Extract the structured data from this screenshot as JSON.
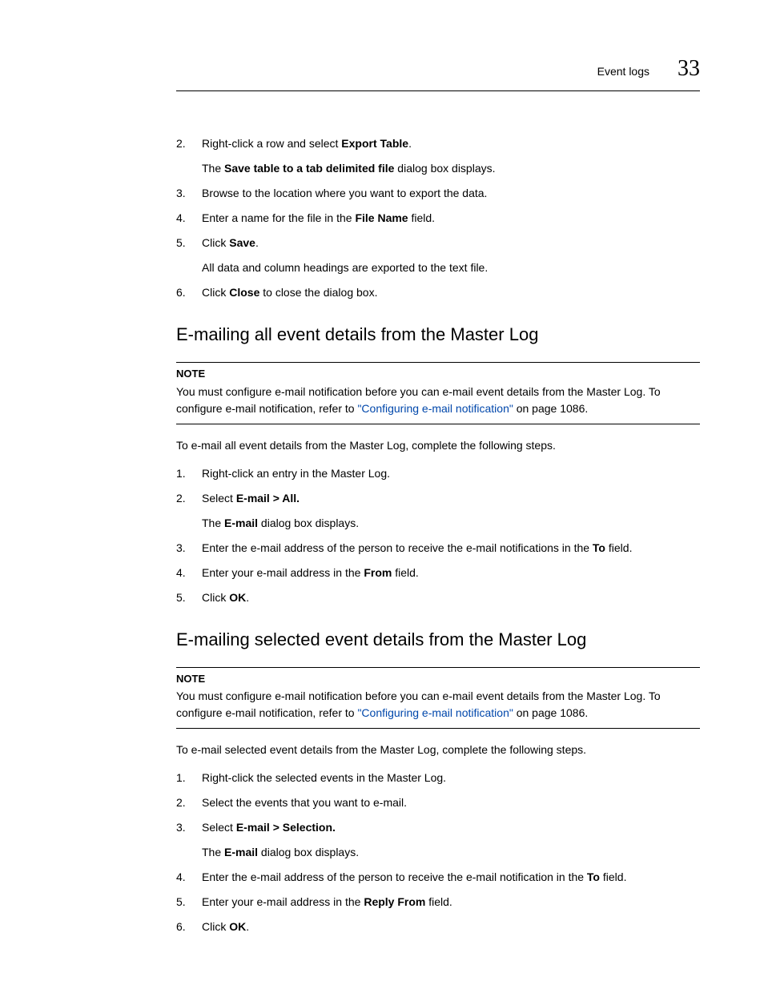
{
  "header": {
    "title": "Event logs",
    "number": "33"
  },
  "section1": {
    "items": [
      {
        "num": "2.",
        "pre": "Right-click a row and select ",
        "bold": "Export Table",
        "post": ".",
        "sub_pre": "The ",
        "sub_bold": "Save table to a tab delimited file",
        "sub_post": " dialog box displays."
      },
      {
        "num": "3.",
        "text": "Browse to the location where you want to export the data."
      },
      {
        "num": "4.",
        "pre": "Enter a name for the file in the ",
        "bold": "File Name",
        "post": " field."
      },
      {
        "num": "5.",
        "pre": "Click ",
        "bold": "Save",
        "post": ".",
        "sub_text": "All data and column headings are exported to the text file."
      },
      {
        "num": "6.",
        "pre": "Click ",
        "bold": "Close",
        "post": " to close the dialog box."
      }
    ]
  },
  "section2": {
    "heading": "E-mailing all event details from the Master Log",
    "note_label": "NOTE",
    "note_pre": "You must configure e-mail notification before you can e-mail event details from the Master Log. To configure e-mail notification, refer to ",
    "note_link": "\"Configuring e-mail notification\"",
    "note_post": " on page 1086.",
    "intro": "To e-mail all event details from the Master Log, complete the following steps.",
    "items": [
      {
        "num": "1.",
        "text": "Right-click an entry in the Master Log."
      },
      {
        "num": "2.",
        "pre": "Select ",
        "bold": "E-mail > All.",
        "sub_pre": "The ",
        "sub_bold": "E-mail",
        "sub_post": " dialog box displays."
      },
      {
        "num": "3.",
        "pre": "Enter the e-mail address of the person to receive the e-mail notifications in the ",
        "bold": "To",
        "post": " field."
      },
      {
        "num": "4.",
        "pre": "Enter your e-mail address in the ",
        "bold": "From",
        "post": " field."
      },
      {
        "num": "5.",
        "pre": "Click ",
        "bold": "OK",
        "post": "."
      }
    ]
  },
  "section3": {
    "heading": "E-mailing selected event details from the Master Log",
    "note_label": "NOTE",
    "note_pre": "You must configure e-mail notification before you can e-mail event details from the Master Log. To configure e-mail notification, refer to ",
    "note_link": "\"Configuring e-mail notification\"",
    "note_post": " on page 1086.",
    "intro": "To e-mail selected event details from the Master Log, complete the following steps.",
    "items": [
      {
        "num": "1.",
        "text": "Right-click the selected events in the Master Log."
      },
      {
        "num": "2.",
        "text": "Select the events that you want to e-mail."
      },
      {
        "num": "3.",
        "pre": "Select ",
        "bold": "E-mail > Selection.",
        "sub_pre": "The ",
        "sub_bold": "E-mail",
        "sub_post": " dialog box displays."
      },
      {
        "num": "4.",
        "pre": "Enter the e-mail address of the person to receive the e-mail notification in the ",
        "bold": "To",
        "post": " field."
      },
      {
        "num": "5.",
        "pre": "Enter your e-mail address in the ",
        "bold": "Reply From",
        "post": " field."
      },
      {
        "num": "6.",
        "pre": "Click ",
        "bold": "OK",
        "post": "."
      }
    ]
  }
}
